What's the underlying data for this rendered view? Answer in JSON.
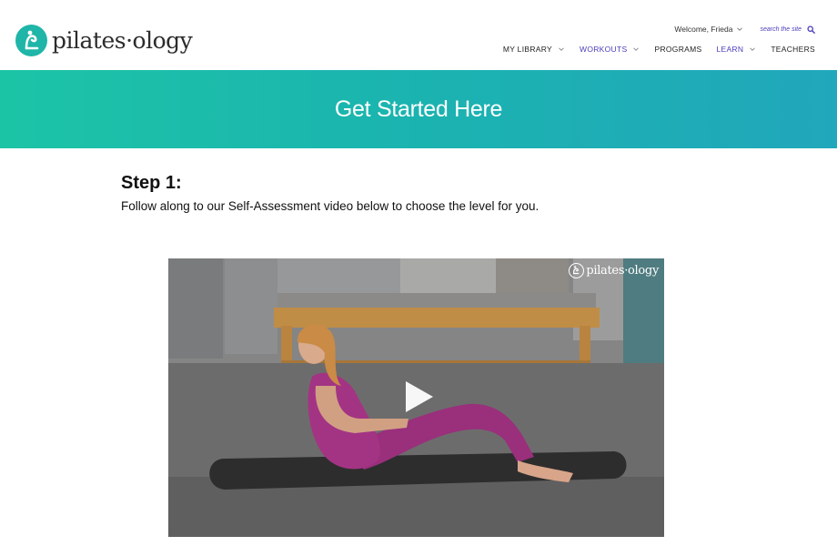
{
  "brand": {
    "logo_text": "pilates·ology",
    "accent_color": "#1fb5a8",
    "link_color": "#4a3dbb"
  },
  "header": {
    "welcome": "Welcome, Frieda",
    "search_label": "search the site"
  },
  "nav": {
    "items": [
      {
        "label": "MY LIBRARY",
        "has_dropdown": true
      },
      {
        "label": "WORKOUTS",
        "has_dropdown": true
      },
      {
        "label": "PROGRAMS",
        "has_dropdown": false
      },
      {
        "label": "LEARN",
        "has_dropdown": true
      },
      {
        "label": "TEACHERS",
        "has_dropdown": false
      }
    ]
  },
  "banner": {
    "title": "Get Started Here",
    "gradient": [
      "#1cc4a6",
      "#21a7bb"
    ]
  },
  "content": {
    "step_heading": "Step 1:",
    "step_text": "Follow along to our Self-Assessment video below to choose the level for you."
  },
  "video": {
    "watermark": "pilates·ology",
    "play_icon": "play-icon"
  }
}
